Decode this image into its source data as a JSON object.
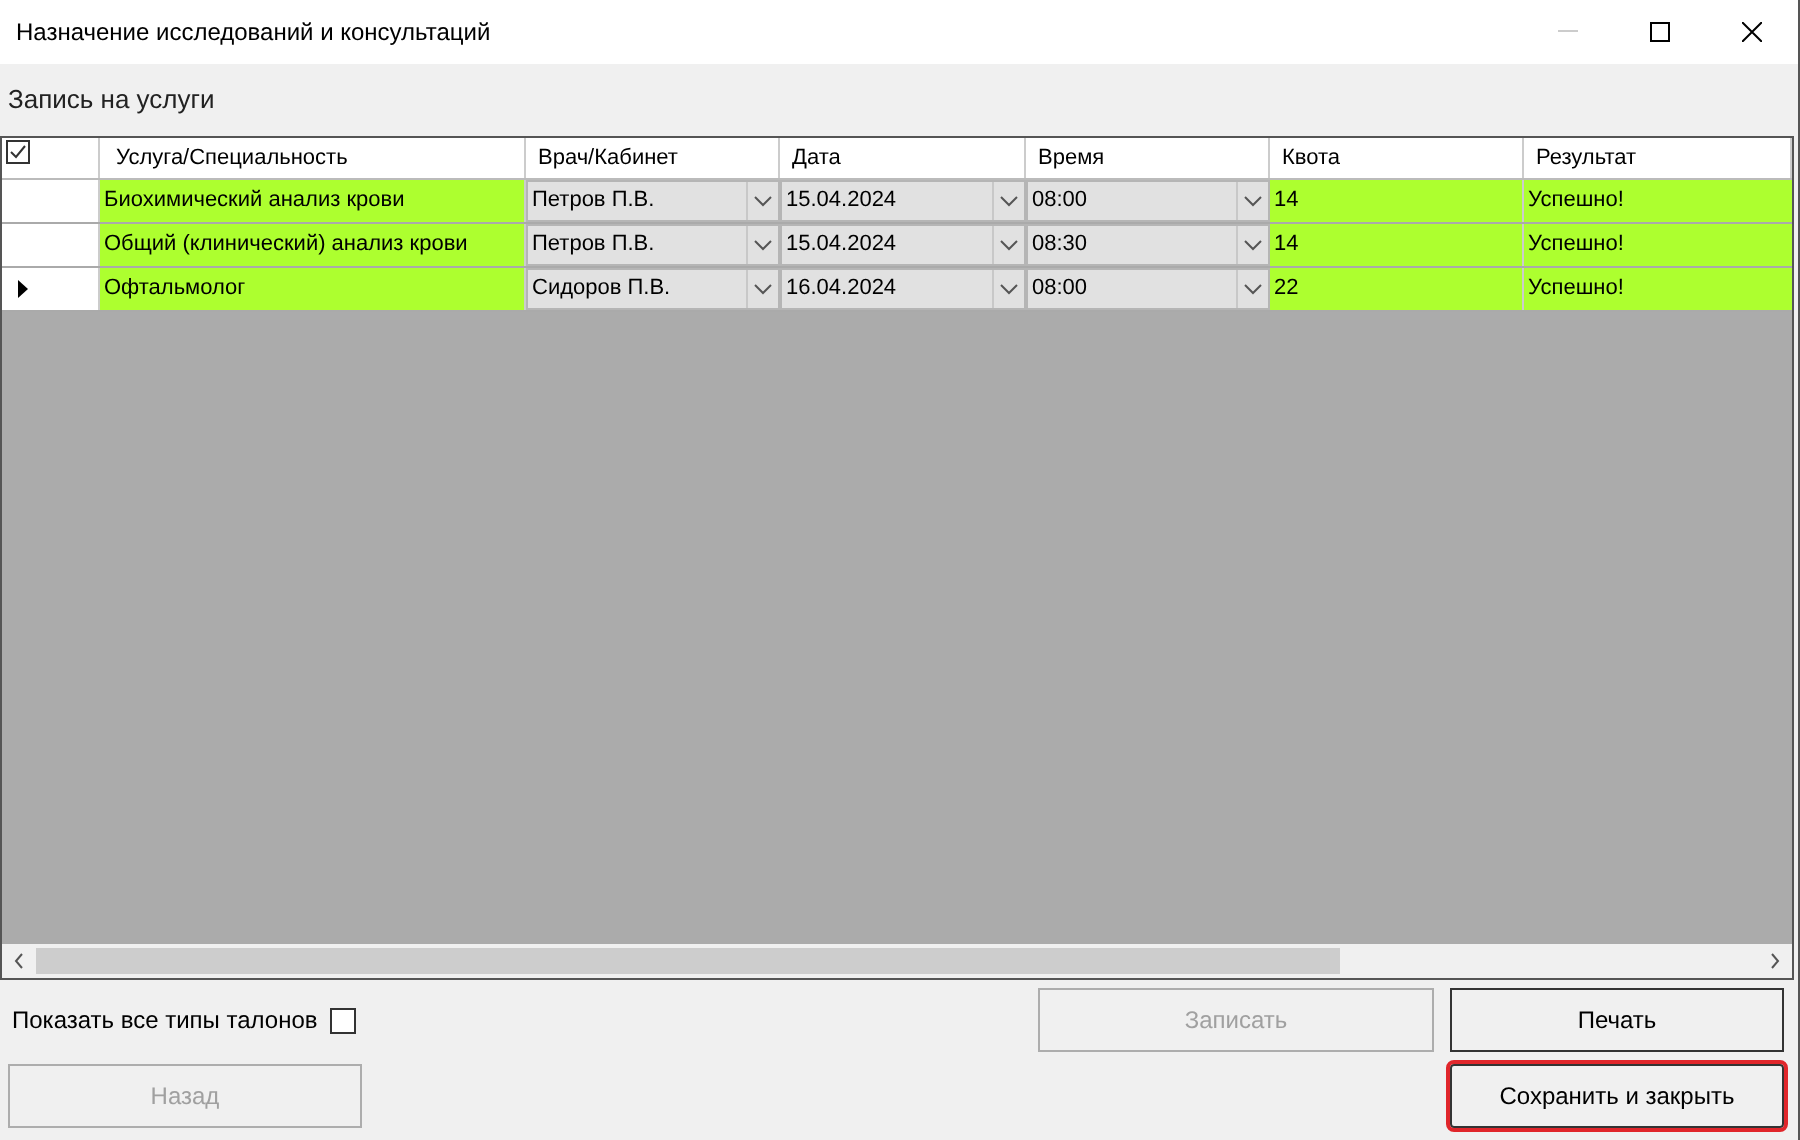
{
  "window": {
    "title": "Назначение исследований и консультаций"
  },
  "section_label": "Запись на услуги",
  "table": {
    "select_all_checked": true,
    "columns": [
      "Услуга/Специальность",
      "Врач/Кабинет",
      "Дата",
      "Время",
      "Квота",
      "Результат"
    ],
    "rows": [
      {
        "current": false,
        "service": "Биохимический анализ крови",
        "doctor": "Петров П.В.",
        "date": "15.04.2024",
        "time": "08:00",
        "quota": "14",
        "result": "Успешно!",
        "color": "#adff2f"
      },
      {
        "current": false,
        "service": "Общий (клинический) анализ крови",
        "doctor": "Петров П.В.",
        "date": "15.04.2024",
        "time": "08:30",
        "quota": "14",
        "result": "Успешно!",
        "color": "#adff2f"
      },
      {
        "current": true,
        "service": "Офтальмолог",
        "doctor": "Сидоров П.В.",
        "date": "16.04.2024",
        "time": "08:00",
        "quota": "22",
        "result": "Успешно!",
        "color": "#adff2f"
      }
    ]
  },
  "show_all_types": {
    "label": "Показать все типы талонов",
    "checked": false
  },
  "buttons": [
    {
      "label": "Записать",
      "disabled": true,
      "highlighted": false
    },
    {
      "label": "Печать",
      "disabled": false,
      "highlighted": false
    },
    {
      "label": "Назад",
      "disabled": true,
      "highlighted": false
    },
    {
      "label": "Сохранить и закрыть",
      "disabled": false,
      "highlighted": true
    }
  ]
}
